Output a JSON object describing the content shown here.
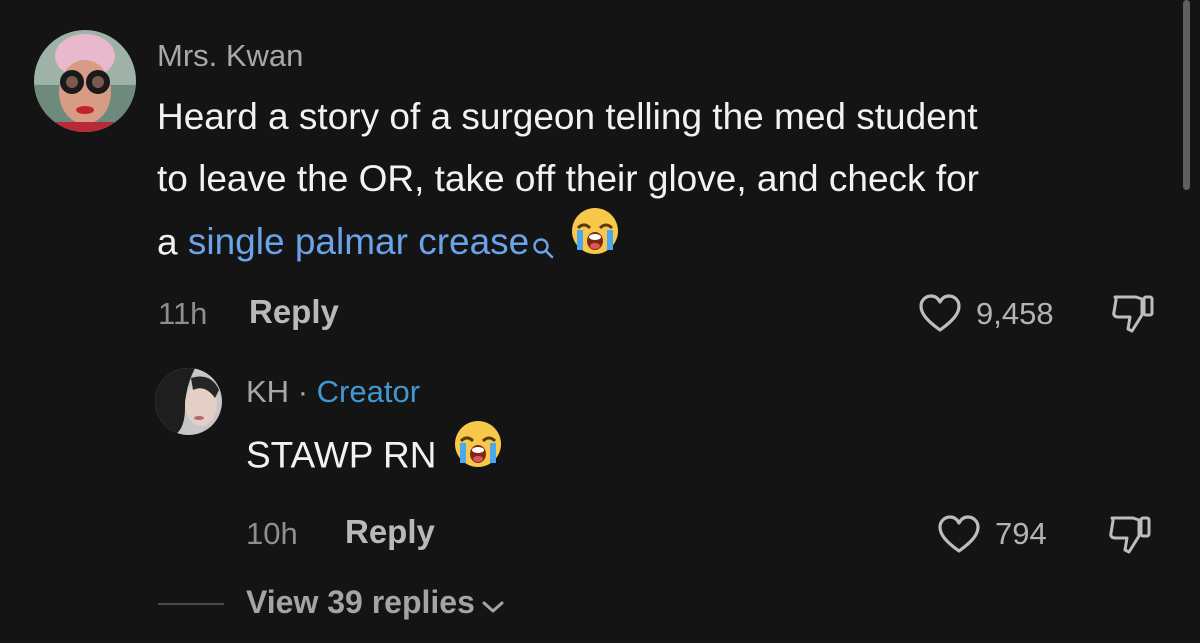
{
  "comment": {
    "author": "Mrs. Kwan",
    "text_line1": "Heard a story of a surgeon telling the med student",
    "text_line2": "to leave the OR, take off their glove, and check for",
    "text_line3_prefix": "a ",
    "search_link": "single palmar crease",
    "emoji_icon": "loudly-crying-face-icon",
    "time": "11h",
    "reply_label": "Reply",
    "like_count": "9,458"
  },
  "reply": {
    "author": "KH",
    "separator": "·",
    "badge": "Creator",
    "text": "STAWP RN",
    "emoji_icon": "loudly-crying-face-icon",
    "time": "10h",
    "reply_label": "Reply",
    "like_count": "794"
  },
  "view_replies": {
    "label": "View 39 replies"
  },
  "colors": {
    "background": "#141414",
    "link": "#6aa3ea",
    "creator": "#3f98cf",
    "text": "#f2f2f2",
    "muted": "#8e8e8e"
  }
}
